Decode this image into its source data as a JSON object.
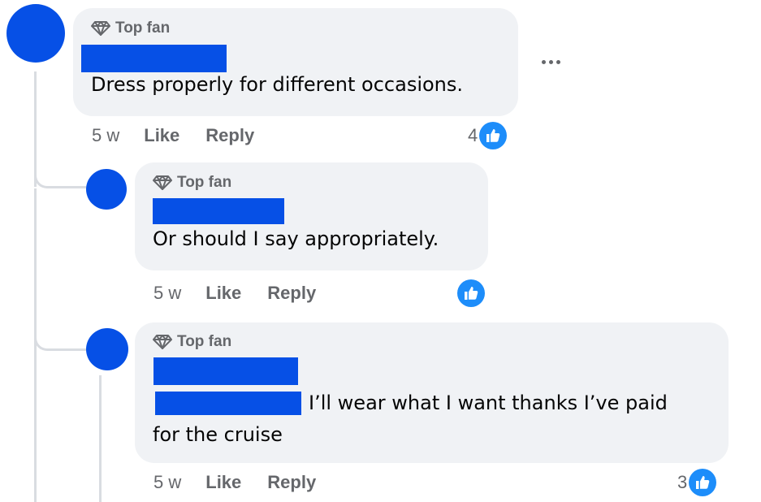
{
  "comments": [
    {
      "badge": "Top fan",
      "text": "Dress properly for different occasions.",
      "time": "5 w",
      "like_label": "Like",
      "reply_label": "Reply",
      "reaction_count": "4"
    },
    {
      "badge": "Top fan",
      "text": "Or should I say appropriately.",
      "time": "5 w",
      "like_label": "Like",
      "reply_label": "Reply",
      "reaction_count": ""
    },
    {
      "badge": "Top fan",
      "text_line1": "I’ll wear what I want thanks I’ve paid",
      "text_line2": "for the cruise",
      "time": "5 w",
      "like_label": "Like",
      "reply_label": "Reply",
      "reaction_count": "3"
    }
  ],
  "icons": {
    "badge": "diamond-icon",
    "reaction": "thumbs-up-icon",
    "menu": "more-options-icon"
  },
  "colors": {
    "avatar": "#0650e6",
    "redaction": "#0650e6",
    "bubble": "#f0f2f5",
    "like_reaction": "#1d8dfa",
    "muted_text": "#65676b"
  }
}
